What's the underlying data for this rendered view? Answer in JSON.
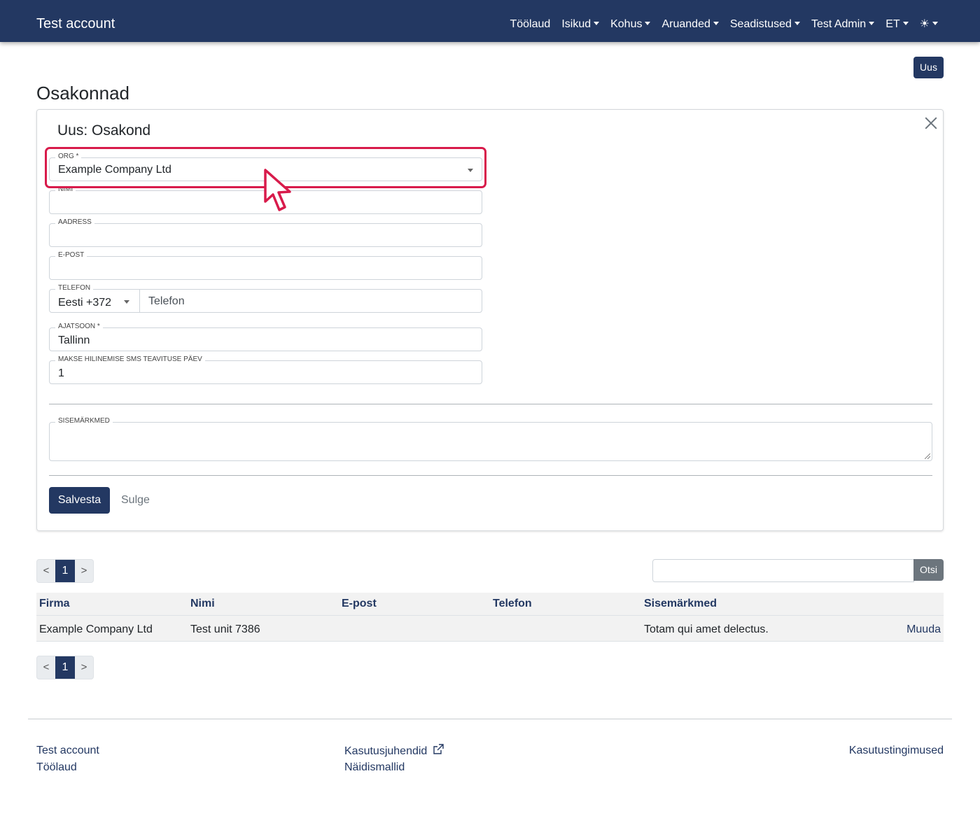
{
  "navbar": {
    "brand": "Test account",
    "items": [
      {
        "label": "Töölaud",
        "dropdown": false
      },
      {
        "label": "Isikud",
        "dropdown": true
      },
      {
        "label": "Kohus",
        "dropdown": true
      },
      {
        "label": "Aruanded",
        "dropdown": true
      },
      {
        "label": "Seadistused",
        "dropdown": true
      },
      {
        "label": "Test Admin",
        "dropdown": true
      },
      {
        "label": "ET",
        "dropdown": true
      },
      {
        "label": "☀",
        "dropdown": true
      }
    ]
  },
  "new_button_label": "Uus",
  "page_title": "Osakonnad",
  "form": {
    "title": "Uus: Osakond",
    "org": {
      "label": "ORG *",
      "value": "Example Company Ltd"
    },
    "nimi": {
      "label": "NIMI",
      "value": ""
    },
    "aadress": {
      "label": "AADRESS",
      "value": ""
    },
    "epost": {
      "label": "E-POST",
      "value": ""
    },
    "telefon": {
      "label": "TELEFON",
      "country": "Eesti +372",
      "placeholder": "Telefon"
    },
    "ajatsoon": {
      "label": "AJATSOON *",
      "value": "Tallinn"
    },
    "sms_day": {
      "label": "MAKSE HILINEMISE SMS TEAVITUSE PÄEV",
      "value": "1"
    },
    "notes": {
      "label": "SISEMÄRKMED",
      "value": ""
    },
    "save_label": "Salvesta",
    "close_label": "Sulge"
  },
  "pagination": {
    "prev": "<",
    "current": "1",
    "next": ">"
  },
  "search": {
    "button_label": "Otsi",
    "value": ""
  },
  "table": {
    "headers": [
      "Firma",
      "Nimi",
      "E-post",
      "Telefon",
      "Sisemärkmed"
    ],
    "rows": [
      {
        "firma": "Example Company Ltd",
        "nimi": "Test unit 7386",
        "epost": "",
        "telefon": "",
        "notes": "Totam qui amet delectus.",
        "action": "Muuda"
      }
    ]
  },
  "footer": {
    "col1": [
      "Test account",
      "Töölaud"
    ],
    "col2": [
      "Kasutusjuhendid",
      "Näidismallid"
    ],
    "col3": [
      "Kasutustingimused"
    ]
  },
  "colors": {
    "primary": "#233862",
    "highlight": "#d81b4b",
    "secondary": "#6c757d"
  }
}
